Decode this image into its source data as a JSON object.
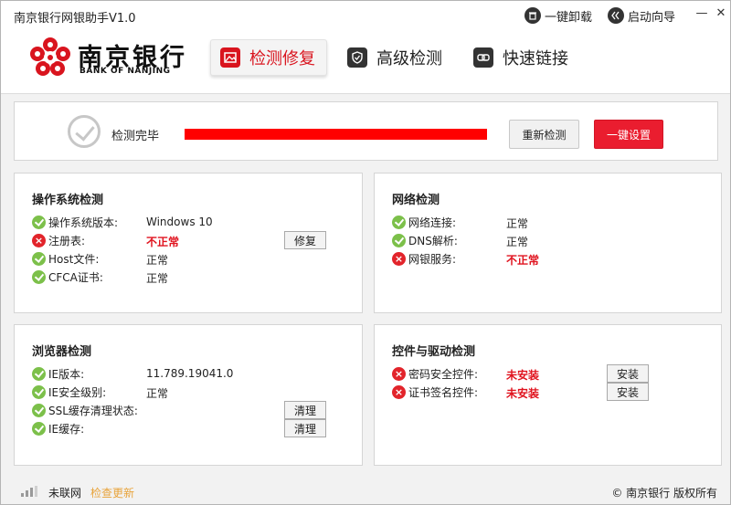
{
  "app": {
    "title": "南京银行网银助手V1.0"
  },
  "titlebar": {
    "uninstall": "一键卸载",
    "wizard": "启动向导",
    "minimize": "—",
    "close": "✕"
  },
  "brand": {
    "name_cn": "南京银行",
    "name_en": "BANK OF NANJING"
  },
  "nav": {
    "tabs": [
      {
        "label": "检测修复",
        "active": true,
        "icon": "image-icon"
      },
      {
        "label": "高级检测",
        "active": false,
        "icon": "shield-icon"
      },
      {
        "label": "快速链接",
        "active": false,
        "icon": "link-icon"
      }
    ]
  },
  "status": {
    "label": "检测完毕",
    "progress": 1.0,
    "recheck": "重新检测",
    "one_click": "一键设置"
  },
  "os_card": {
    "title": "操作系统检测",
    "rows": [
      {
        "label": "操作系统版本:",
        "value": "Windows 10",
        "ok": true
      },
      {
        "label": "注册表:",
        "value": "不正常",
        "ok": false,
        "action": "修复"
      },
      {
        "label": "Host文件:",
        "value": "正常",
        "ok": true
      },
      {
        "label": "CFCA证书:",
        "value": "正常",
        "ok": true
      }
    ]
  },
  "net_card": {
    "title": "网络检测",
    "rows": [
      {
        "label": "网络连接:",
        "value": "正常",
        "ok": true
      },
      {
        "label": "DNS解析:",
        "value": "正常",
        "ok": true
      },
      {
        "label": "网银服务:",
        "value": "不正常",
        "ok": false
      }
    ]
  },
  "browser_card": {
    "title": "浏览器检测",
    "rows": [
      {
        "label": "IE版本:",
        "value": "11.789.19041.0",
        "ok": true
      },
      {
        "label": "IE安全级别:",
        "value": "正常",
        "ok": true
      },
      {
        "label": "SSL缓存清理状态:",
        "value": "",
        "ok": true,
        "action": "清理"
      },
      {
        "label": "IE缓存:",
        "value": "",
        "ok": true,
        "action": "清理"
      }
    ]
  },
  "driver_card": {
    "title": "控件与驱动检测",
    "rows": [
      {
        "label": "密码安全控件:",
        "value": "未安装",
        "ok": false,
        "action": "安装"
      },
      {
        "label": "证书签名控件:",
        "value": "未安装",
        "ok": false,
        "action": "安装"
      }
    ]
  },
  "footer": {
    "network": "未联网",
    "update": "检查更新",
    "copyright": "© 南京银行 版权所有"
  },
  "colors": {
    "brand_red": "#d9141e",
    "ok_green": "#7cc04a",
    "error_red": "#e2242b",
    "progress_red": "#ff0000",
    "update_orange": "#e8a33a"
  }
}
